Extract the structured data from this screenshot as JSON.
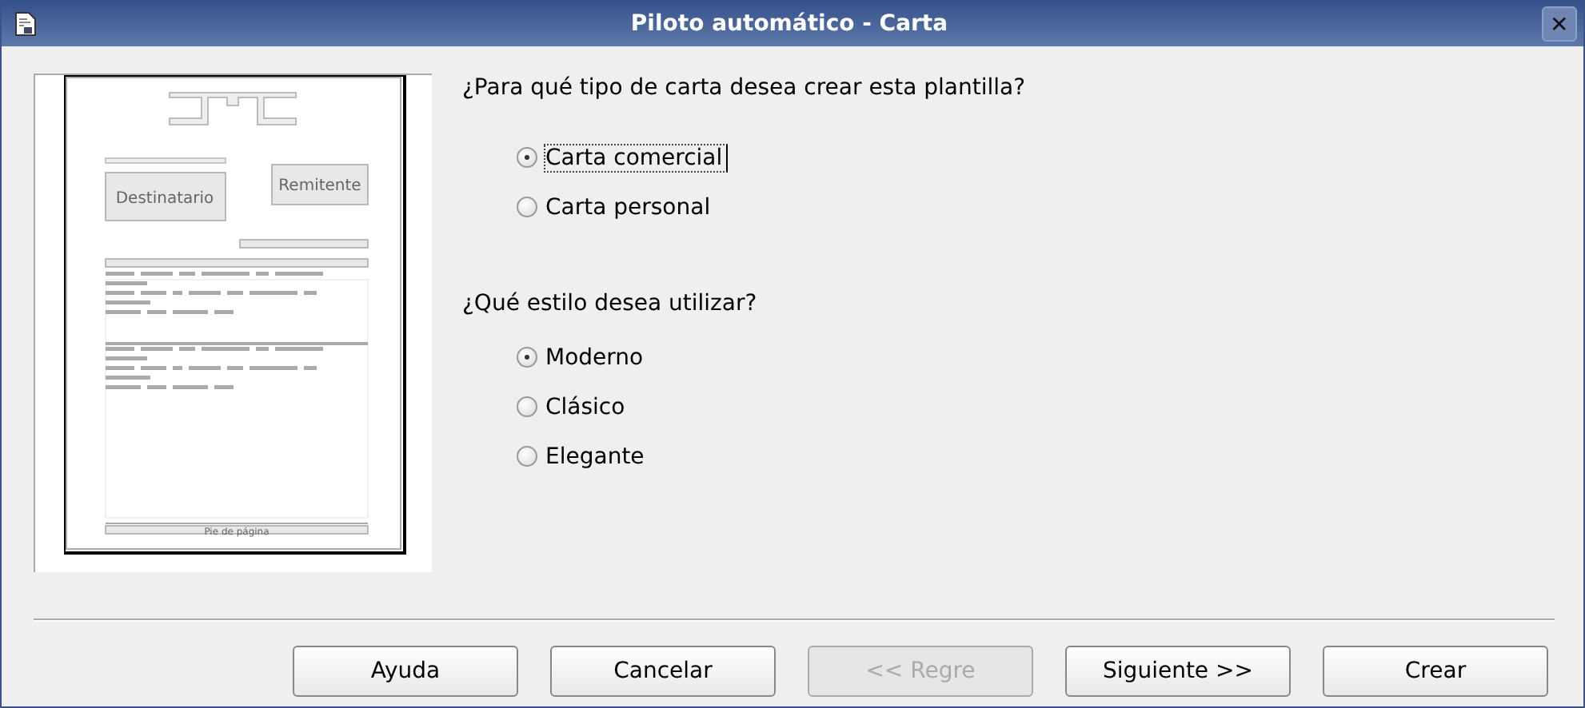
{
  "window": {
    "title": "Piloto automático - Carta",
    "close": "✕"
  },
  "preview": {
    "recipient": "Destinatario",
    "sender": "Remitente",
    "footer": "Pie de página"
  },
  "groups": [
    {
      "question": "¿Para qué tipo de carta desea crear esta plantilla?",
      "options": [
        {
          "label": "Carta comercial",
          "selected": true,
          "focused": true
        },
        {
          "label": "Carta personal",
          "selected": false,
          "focused": false
        }
      ]
    },
    {
      "question": "¿Qué estilo desea utilizar?",
      "options": [
        {
          "label": "Moderno",
          "selected": true,
          "focused": false
        },
        {
          "label": "Clásico",
          "selected": false,
          "focused": false
        },
        {
          "label": "Elegante",
          "selected": false,
          "focused": false
        }
      ]
    }
  ],
  "buttons": [
    {
      "label": "Ayuda",
      "disabled": false
    },
    {
      "label": "Cancelar",
      "disabled": false
    },
    {
      "label": "<< Regre",
      "disabled": true
    },
    {
      "label": "Siguiente >>",
      "disabled": false
    },
    {
      "label": "Crear",
      "disabled": false
    }
  ]
}
